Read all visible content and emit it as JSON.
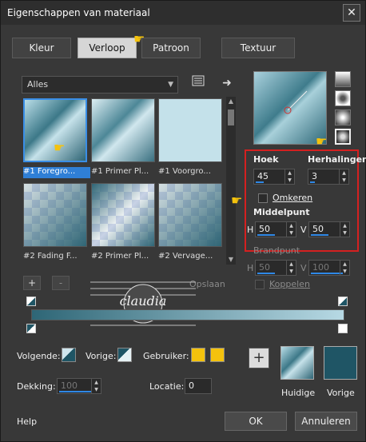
{
  "window": {
    "title": "Eigenschappen van materiaal",
    "close_label": "✕"
  },
  "tabs": [
    {
      "label": "Kleur"
    },
    {
      "label": "Verloop"
    },
    {
      "label": "Patroon"
    },
    {
      "label": "Textuur"
    }
  ],
  "category": {
    "selected": "Alles"
  },
  "gradients": [
    {
      "caption": "#1 Foregro..."
    },
    {
      "caption": "#1 Primer Pl..."
    },
    {
      "caption": "#1 Voorgro..."
    },
    {
      "caption": "#2 Fading F..."
    },
    {
      "caption": "#2 Primer Pl..."
    },
    {
      "caption": "#2 Vervage..."
    }
  ],
  "settings": {
    "angle_label": "Hoek",
    "angle_value": "45",
    "repeats_label": "Herhalingen",
    "repeats_value": "3",
    "invert_label": "Omkeren",
    "center_label": "Middelpunt",
    "center_h_label": "H",
    "center_h_value": "50",
    "center_v_label": "V",
    "center_v_value": "50",
    "focal_label": "Brandpunt",
    "focal_h_label": "H",
    "focal_h_value": "50",
    "focal_v_label": "V",
    "focal_v_value": "100",
    "link_label": "Koppelen"
  },
  "editor": {
    "add_label": "+",
    "remove_label": "-",
    "save_label": "Opslaan",
    "watermark": "claudia"
  },
  "bottom": {
    "following_label": "Volgende:",
    "previous_label": "Vorige:",
    "user_label": "Gebruiker:",
    "opacity_label": "Dekking:",
    "opacity_value": "100",
    "location_label": "Locatie:",
    "location_value": "0",
    "add_label": "+",
    "current_label": "Huidige",
    "previous_swatch_label": "Vorige"
  },
  "footer": {
    "help_label": "Help",
    "ok_label": "OK",
    "cancel_label": "Annuleren"
  },
  "colors": {
    "accent": "#2f88e6",
    "gold": "#f4c20d",
    "teal_dark": "#1f5565",
    "teal_light": "#b7d9e4",
    "highlight_red": "#d42020"
  },
  "icons": [
    "pointer-hand-icon",
    "list-icon",
    "arrow-right-icon",
    "gradient-type-linear-icon",
    "gradient-type-rectangle-icon",
    "gradient-type-sunburst-icon",
    "gradient-type-radial-icon"
  ]
}
